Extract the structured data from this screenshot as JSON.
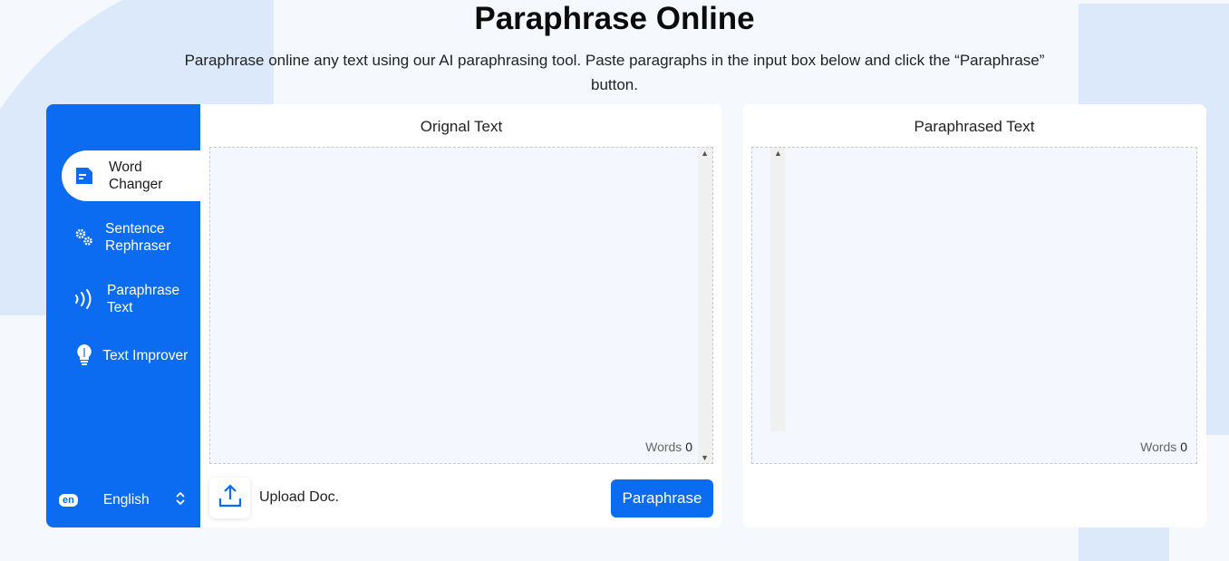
{
  "header": {
    "title": "Paraphrase Online",
    "subtitle": "Paraphrase online any text using our AI paraphrasing tool. Paste paragraphs in the input box below and click the “Paraphrase” button."
  },
  "sidebar": {
    "items": [
      {
        "label": "Word Changer",
        "icon": "document-icon",
        "active": true
      },
      {
        "label": "Sentence Rephraser",
        "icon": "gears-icon",
        "active": false
      },
      {
        "label": "Paraphrase Text",
        "icon": "sound-waves-icon",
        "active": false
      },
      {
        "label": "Text Improver",
        "icon": "lightbulb-icon",
        "active": false
      }
    ],
    "language": {
      "badge": "en",
      "label": "English"
    }
  },
  "original": {
    "title": "Orignal Text",
    "words_label": "Words",
    "words_count": "0",
    "upload_label": "Upload Doc.",
    "paraphrase_button": "Paraphrase"
  },
  "paraphrased": {
    "title": "Paraphrased Text",
    "words_label": "Words",
    "words_count": "0"
  },
  "colors": {
    "accent": "#0b6cf2",
    "background": "#f5f8fd",
    "textbox": "#f4f7fd"
  }
}
